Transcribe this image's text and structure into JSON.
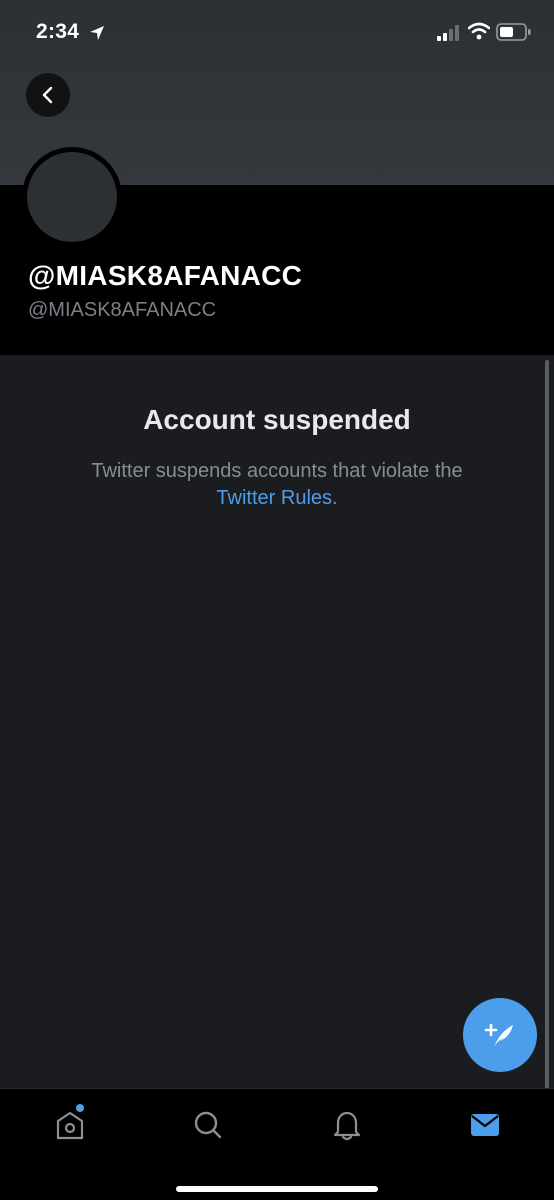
{
  "status_bar": {
    "time": "2:34",
    "icons": [
      "location-arrow-icon",
      "cellular-signal-icon",
      "wifi-icon",
      "battery-icon"
    ]
  },
  "header": {
    "back_icon": "chevron-left-icon"
  },
  "profile": {
    "display_name": "@MIASK8AFANACC",
    "handle": "@MIASK8AFANACC"
  },
  "suspension": {
    "title": "Account suspended",
    "body": "Twitter suspends accounts that violate the",
    "link_text": "Twitter Rules",
    "trailing": "."
  },
  "compose": {
    "icon": "compose-tweet-icon"
  },
  "tab_bar": {
    "tabs": [
      {
        "name": "home",
        "icon": "home-icon",
        "has_dot": true
      },
      {
        "name": "search",
        "icon": "search-icon"
      },
      {
        "name": "notifications",
        "icon": "bell-icon"
      },
      {
        "name": "messages",
        "icon": "mail-icon",
        "active": true
      }
    ]
  },
  "colors": {
    "accent": "#4c9eeb",
    "background": "#1b1c20",
    "header_black": "#000000",
    "banner": "#2f3237"
  }
}
